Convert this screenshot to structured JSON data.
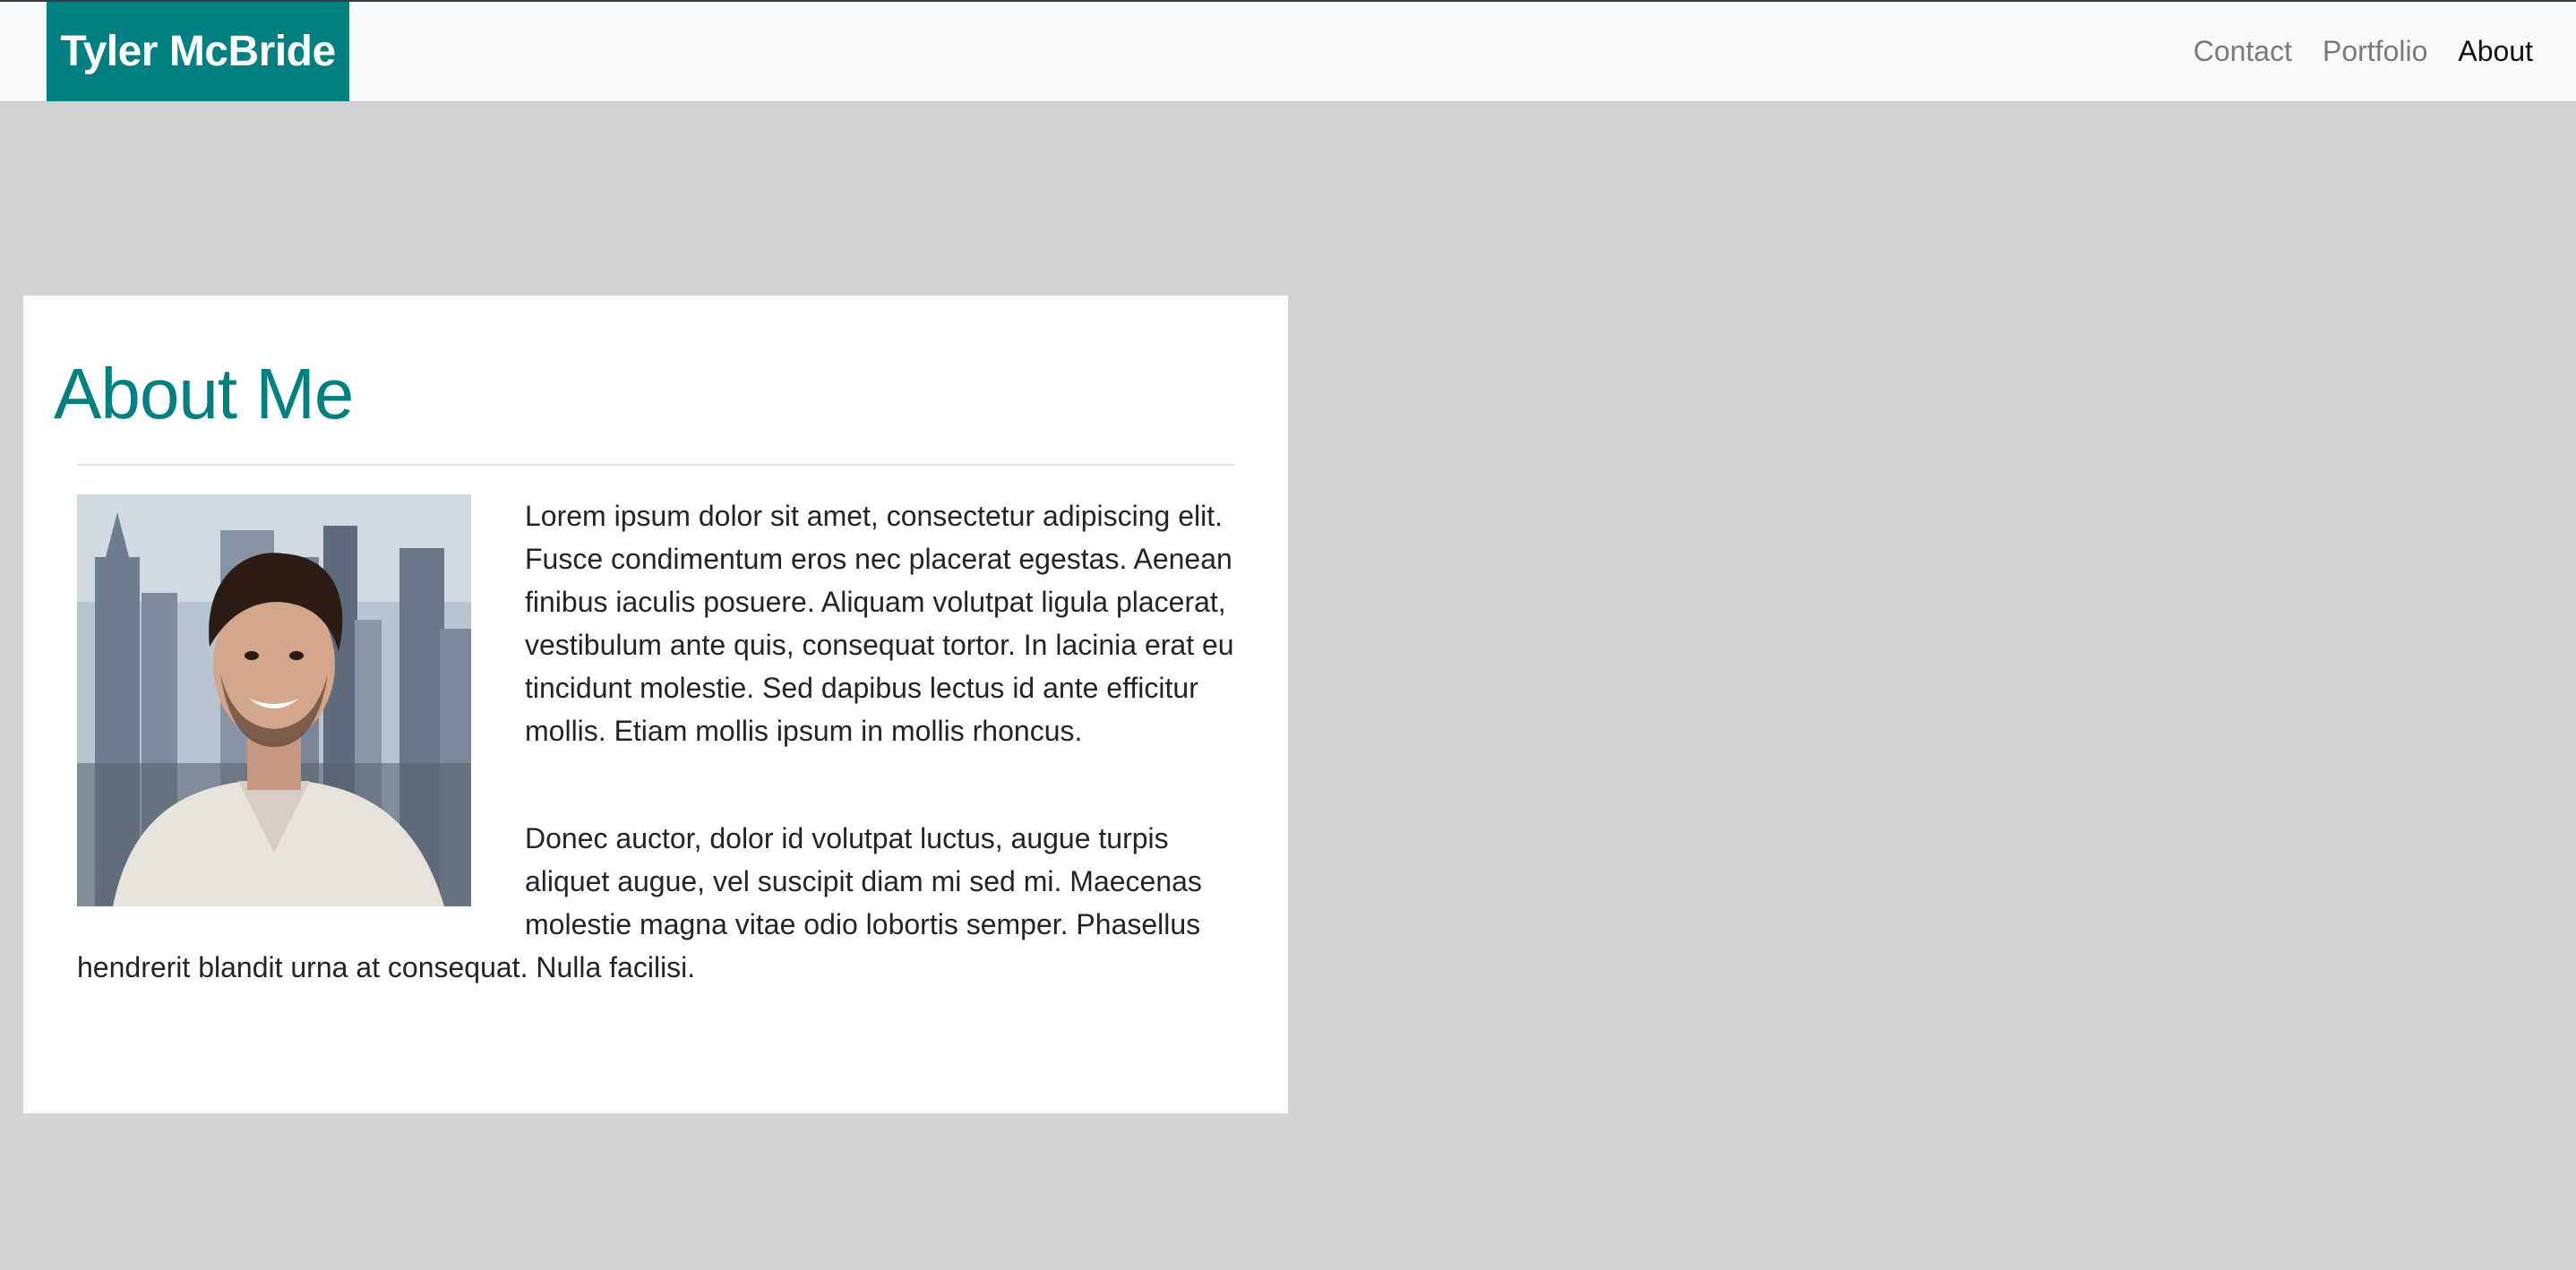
{
  "navbar": {
    "brand": "Tyler McBride",
    "links": [
      {
        "label": "Contact",
        "active": false
      },
      {
        "label": "Portfolio",
        "active": false
      },
      {
        "label": "About",
        "active": true
      }
    ]
  },
  "about": {
    "title": "About Me",
    "paragraphs": [
      "Lorem ipsum dolor sit amet, consectetur adipiscing elit. Fusce condimentum eros nec placerat egestas. Aenean finibus iaculis posuere. Aliquam volutpat ligula placerat, vestibulum ante quis, consequat tortor. In lacinia erat eu tincidunt molestie. Sed dapibus lectus id ante efficitur mollis. Etiam mollis ipsum in mollis rhoncus.",
      "Donec auctor, dolor id volutpat luctus, augue turpis aliquet augue, vel suscipit diam mi sed mi. Maecenas molestie magna vitae odio lobortis semper. Phasellus hendrerit blandit urna at consequat. Nulla facilisi."
    ]
  },
  "colors": {
    "accent": "#008080",
    "background": "#d3d3d3",
    "navbar_bg": "#f8f9fa",
    "card_bg": "#ffffff"
  }
}
